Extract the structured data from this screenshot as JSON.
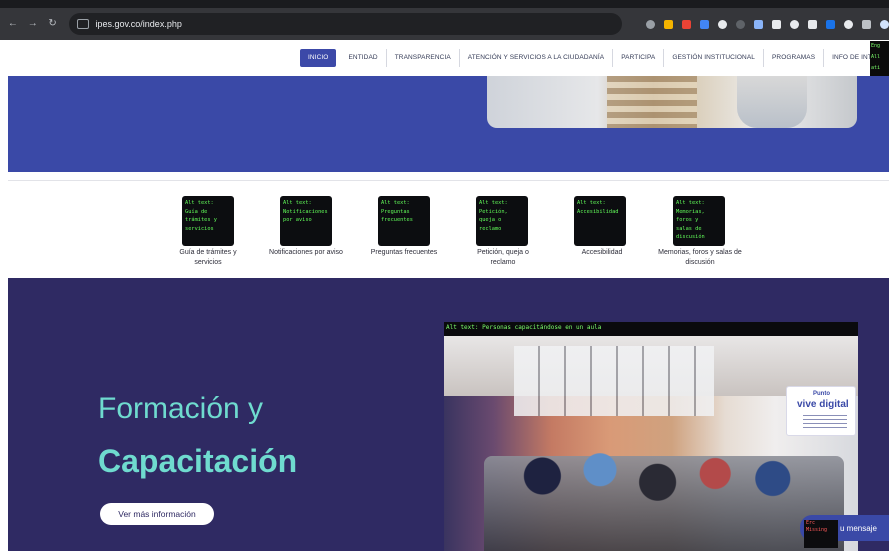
{
  "browser": {
    "url": "ipes.gov.co/index.php"
  },
  "nav": {
    "items": [
      {
        "label": "INICIO",
        "active": true
      },
      {
        "label": "ENTIDAD",
        "active": false
      },
      {
        "label": "TRANSPARENCIA",
        "active": false
      },
      {
        "label": "ATENCIÓN Y SERVICIOS A LA CIUDADANÍA",
        "active": false
      },
      {
        "label": "PARTICIPA",
        "active": false
      },
      {
        "label": "GESTIÓN INSTITUCIONAL",
        "active": false
      },
      {
        "label": "PROGRAMAS",
        "active": false
      },
      {
        "label": "INFO DE INT",
        "active": false
      }
    ],
    "debug_lines": [
      "Eng",
      "All",
      "ati",
      "A",
      "o",
      "m"
    ]
  },
  "quick_links": [
    {
      "alt": "Alt text:\nGuía de\ntrámites y\nservicios",
      "label": "Guía de trámites y servicios"
    },
    {
      "alt": "Alt text:\nNotificaciones\npor aviso",
      "label": "Notificaciones por aviso"
    },
    {
      "alt": "Alt text:\nPreguntas\nfrecuentes",
      "label": "Preguntas frecuentes"
    },
    {
      "alt": "Alt text:\nPetición,\nqueja o\nreclamo",
      "label": "Petición, queja o reclamo"
    },
    {
      "alt": "Alt text:\nAccesibilidad",
      "label": "Accesibilidad"
    },
    {
      "alt": "Alt text:\nMemorias,\nforos y\nsalas de\ndiscusión",
      "label": "Memorias, foros y salas de discusión"
    }
  ],
  "training": {
    "title_line1": "Formación y",
    "title_line2": "Capacitación",
    "button_label": "Ver más información",
    "photo_alt": "Alt text: Personas capacitándose en un aula",
    "sign_top": "Punto",
    "sign_main": "vive digital"
  },
  "chat": {
    "label": "u mensaje",
    "alt_lines": [
      "Erc",
      "Missing"
    ]
  },
  "colors": {
    "brand_blue": "#3a49a7",
    "purple": "#2f2a63",
    "teal_title": "#6fdbcf"
  }
}
